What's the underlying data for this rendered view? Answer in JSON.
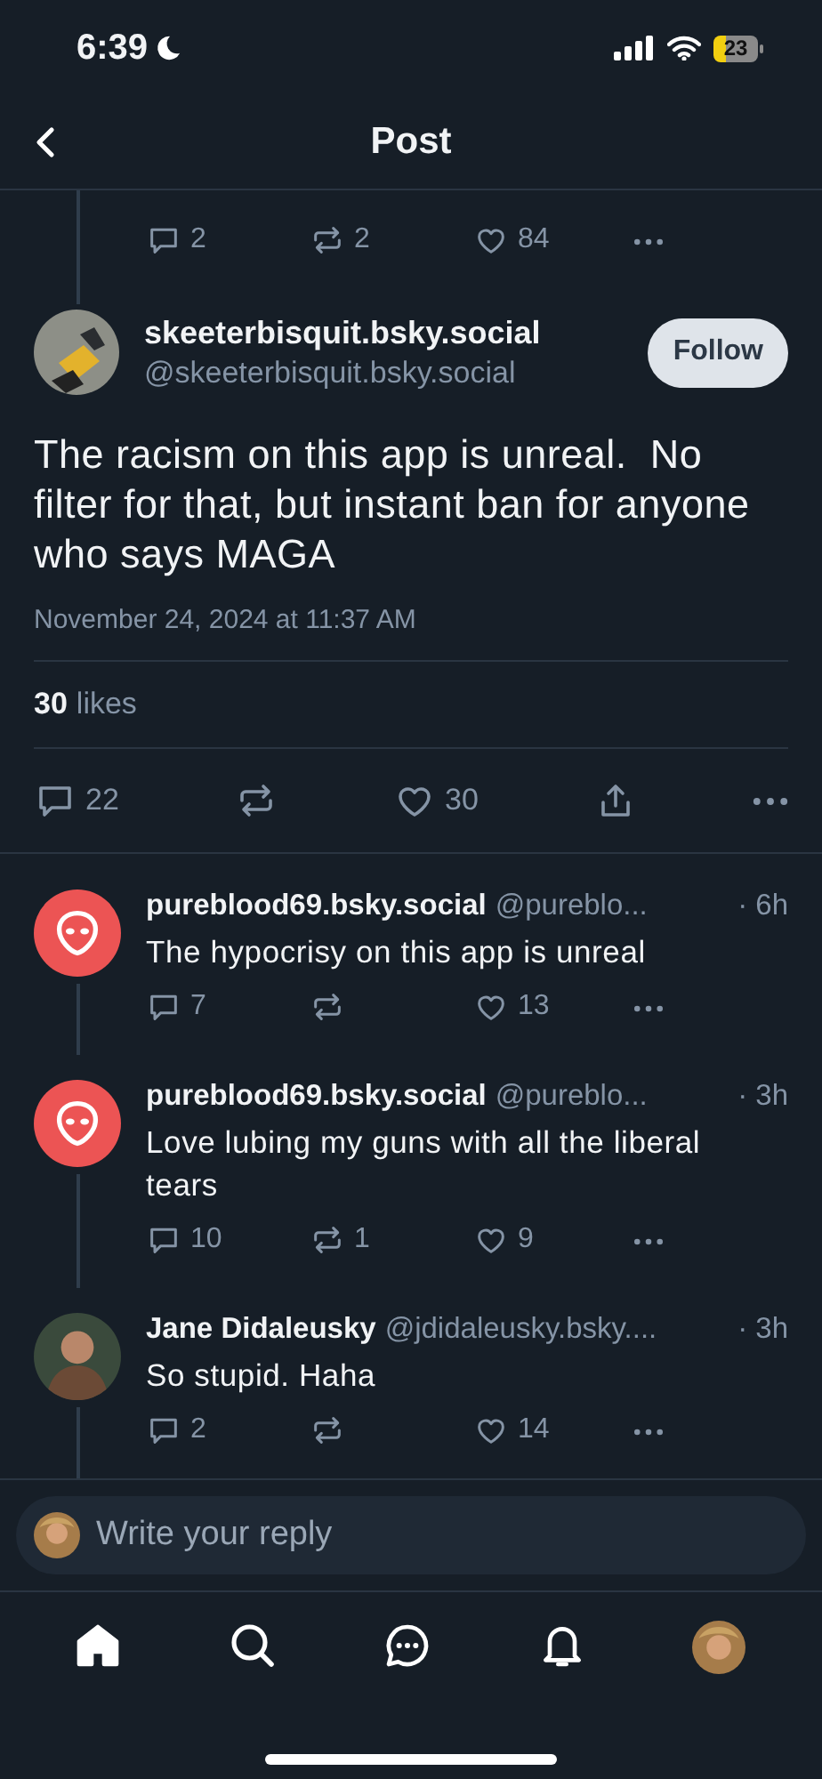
{
  "status_bar": {
    "time": "6:39",
    "battery": "23"
  },
  "header": {
    "title": "Post"
  },
  "parent_post": {
    "actions": {
      "replies": "2",
      "reposts": "2",
      "likes": "84"
    }
  },
  "post": {
    "display_name": "skeeterbisquit.bsky.social",
    "handle": "@skeeterbisquit.bsky.social",
    "follow_button": "Follow",
    "text": "The racism on this app is unreal.  No filter for that, but instant ban for anyone who says MAGA",
    "timestamp": "November 24, 2024 at 11:37 AM",
    "likes_count": "30",
    "likes_label": "likes",
    "actions": {
      "replies": "22",
      "likes": "30"
    }
  },
  "replies": [
    {
      "avatar": {
        "kind": "alien"
      },
      "display_name": "pureblood69.bsky.social",
      "handle": "@pureblo...",
      "time": "· 6h",
      "text": "The hypocrisy on this app is unreal",
      "actions": {
        "replies": "7",
        "likes": "13"
      }
    },
    {
      "avatar": {
        "kind": "alien"
      },
      "display_name": "pureblood69.bsky.social",
      "handle": "@pureblo...",
      "time": "· 3h",
      "text": "Love lubing my guns with all the liberal tears",
      "actions": {
        "replies": "10",
        "reposts": "1",
        "likes": "9"
      }
    },
    {
      "avatar": {
        "kind": "photo"
      },
      "display_name": "Jane Didaleusky",
      "handle": "@jdidaleusky.bsky....",
      "time": "· 3h",
      "text": "So stupid. Haha",
      "actions": {
        "replies": "2",
        "likes": "14"
      }
    }
  ],
  "reply_field": {
    "placeholder": "Write your reply"
  },
  "tab_bar": [
    {
      "kind": "home",
      "selected": true
    },
    {
      "kind": "search",
      "selected": false
    },
    {
      "kind": "chat",
      "selected": false
    },
    {
      "kind": "notifications",
      "selected": false
    },
    {
      "kind": "profile",
      "selected": false
    }
  ]
}
